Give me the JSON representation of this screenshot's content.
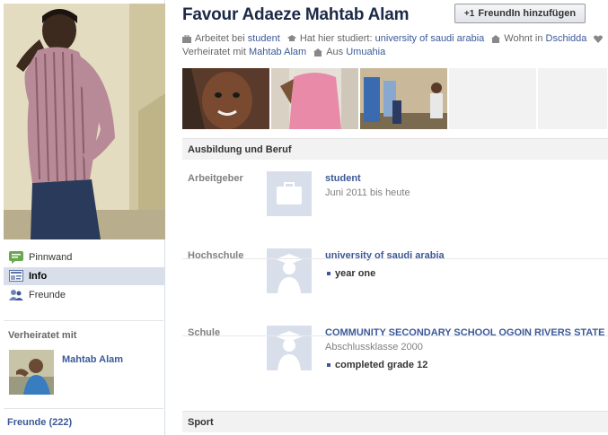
{
  "profile": {
    "name": "Favour Adaeze Mahtab Alam",
    "add_friend_label": "FreundIn hinzufügen",
    "info": {
      "work_prefix": "Arbeitet bei",
      "work_link": "student",
      "studied_prefix": "Hat hier studiert:",
      "studied_link": "university of saudi arabia",
      "lives_prefix": "Wohnt in",
      "lives_link": "Dschidda",
      "married_prefix": "Verheiratet mit",
      "married_link": "Mahtab Alam",
      "from_prefix": "Aus",
      "from_link": "Umuahia"
    }
  },
  "sidebar": {
    "nav": [
      {
        "label": "Pinnwand",
        "icon": "wall-icon"
      },
      {
        "label": "Info",
        "icon": "info-icon"
      },
      {
        "label": "Freunde",
        "icon": "friends-icon"
      }
    ],
    "married_heading": "Verheiratet mit",
    "married_name": "Mahtab Alam",
    "friends_link": "Freunde (222)"
  },
  "sections": {
    "education_title": "Ausbildung und Beruf",
    "employer_label": "Arbeitgeber",
    "employer_name": "student",
    "employer_dates": "Juni 2011 bis heute",
    "college_label": "Hochschule",
    "college_name": "university of saudi arabia",
    "college_bullet": "year one",
    "school_label": "Schule",
    "school_name": "COMMUNITY SECONDARY SCHOOL OGOIN RIVERS STATE",
    "school_class": "Abschlussklasse 2000",
    "school_bullet": "completed grade 12",
    "sport_title": "Sport"
  },
  "colors": {
    "link": "#3b5998",
    "name": "#1c2a47",
    "nav_active_bg": "#d8dfea",
    "section_bg": "#f2f2f2"
  }
}
